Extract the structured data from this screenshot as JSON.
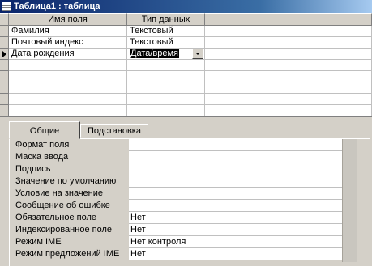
{
  "window": {
    "title": "Таблица1 : таблица"
  },
  "grid": {
    "headers": [
      "Имя поля",
      "Тип данных",
      ""
    ],
    "rows": [
      {
        "name": "Фамилия",
        "type": "Текстовый",
        "desc": ""
      },
      {
        "name": "Почтовый индекс",
        "type": "Текстовый",
        "desc": ""
      },
      {
        "name": "Дата рождения",
        "type": "Дата/время",
        "desc": ""
      }
    ],
    "current_row": 2
  },
  "props": {
    "tabs": [
      "Общие",
      "Подстановка"
    ],
    "active_tab": 0,
    "fields": [
      {
        "label": "Формат поля",
        "value": ""
      },
      {
        "label": "Маска ввода",
        "value": ""
      },
      {
        "label": "Подпись",
        "value": ""
      },
      {
        "label": "Значение по умолчанию",
        "value": ""
      },
      {
        "label": "Условие на значение",
        "value": ""
      },
      {
        "label": "Сообщение об ошибке",
        "value": ""
      },
      {
        "label": "Обязательное поле",
        "value": "Нет"
      },
      {
        "label": "Индексированное поле",
        "value": "Нет"
      },
      {
        "label": "Режим IME",
        "value": "Нет контроля"
      },
      {
        "label": "Режим предложений IME",
        "value": "Нет"
      }
    ]
  },
  "icons": {
    "window": "table-icon",
    "dropdown": "chevron-down-icon",
    "row_pointer": "row-pointer-icon"
  }
}
